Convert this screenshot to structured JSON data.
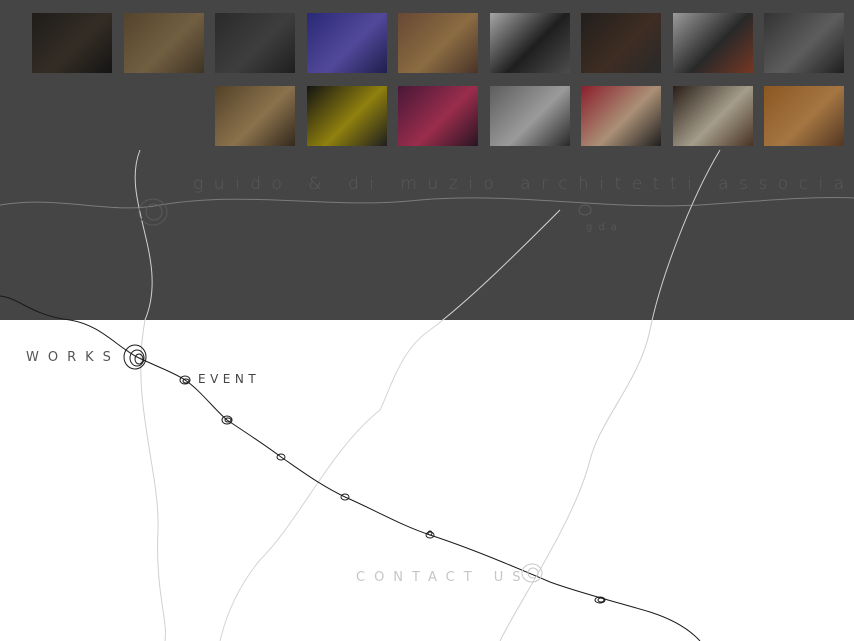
{
  "colors": {
    "top_panel": "#454545",
    "page_background": "#ffffff",
    "thread_line": "#1a1a1a",
    "faint_line": "#d0d0d0"
  },
  "brand": {
    "name": "guido & di muzio architetti associati",
    "subtitle": "gda"
  },
  "nav": {
    "works": "WORKS",
    "event": "EVENT",
    "contact": "CONTACT US"
  },
  "thumbnails": {
    "row1": [
      {
        "name": "thumb-round-mirror",
        "colors": [
          "#1a1712",
          "#3a3023",
          "#0a0a0a"
        ]
      },
      {
        "name": "thumb-warm-room",
        "colors": [
          "#6b5330",
          "#9a7d50",
          "#4a3a22"
        ]
      },
      {
        "name": "thumb-shelves",
        "colors": [
          "#2c2c2c",
          "#4a4a4a",
          "#1a1a1a"
        ]
      },
      {
        "name": "thumb-blue-light",
        "colors": [
          "#2a2aa0",
          "#6a5ad8",
          "#1a1a60"
        ]
      },
      {
        "name": "thumb-yellow-wall",
        "colors": [
          "#8a5a3a",
          "#c09050",
          "#5a3a28"
        ]
      },
      {
        "name": "thumb-black-pattern",
        "colors": [
          "#e8e8e8",
          "#1a1a1a",
          "#606060"
        ]
      },
      {
        "name": "thumb-dark-table",
        "colors": [
          "#1e1a16",
          "#4a3020",
          "#2a2a2a"
        ]
      },
      {
        "name": "thumb-red-bottles",
        "colors": [
          "#d8d8d8",
          "#2a2a2a",
          "#a04020"
        ]
      },
      {
        "name": "thumb-curtain",
        "colors": [
          "#3a3a3a",
          "#7a7a7a",
          "#1a1a1a"
        ]
      }
    ],
    "row2": [
      {
        "name": "thumb-statue",
        "colors": [
          "#6a5028",
          "#c09a60",
          "#3a2a18"
        ]
      },
      {
        "name": "thumb-yellow-rays",
        "colors": [
          "#0a0a0a",
          "#c8b000",
          "#1a1a1a"
        ]
      },
      {
        "name": "thumb-pink-flowers",
        "colors": [
          "#5a1040",
          "#d83060",
          "#2a0a20"
        ]
      },
      {
        "name": "thumb-portrait",
        "colors": [
          "#7a7a7a",
          "#d8d8d8",
          "#2a2a2a"
        ]
      },
      {
        "name": "thumb-red-vase",
        "colors": [
          "#c01a30",
          "#f0c8a0",
          "#1a1a1a"
        ]
      },
      {
        "name": "thumb-white-sculpture",
        "colors": [
          "#2a1a10",
          "#e8dcc0",
          "#5a3a20"
        ]
      },
      {
        "name": "thumb-orange-panel",
        "colors": [
          "#c07020",
          "#e8a050",
          "#6a4020"
        ]
      }
    ]
  }
}
